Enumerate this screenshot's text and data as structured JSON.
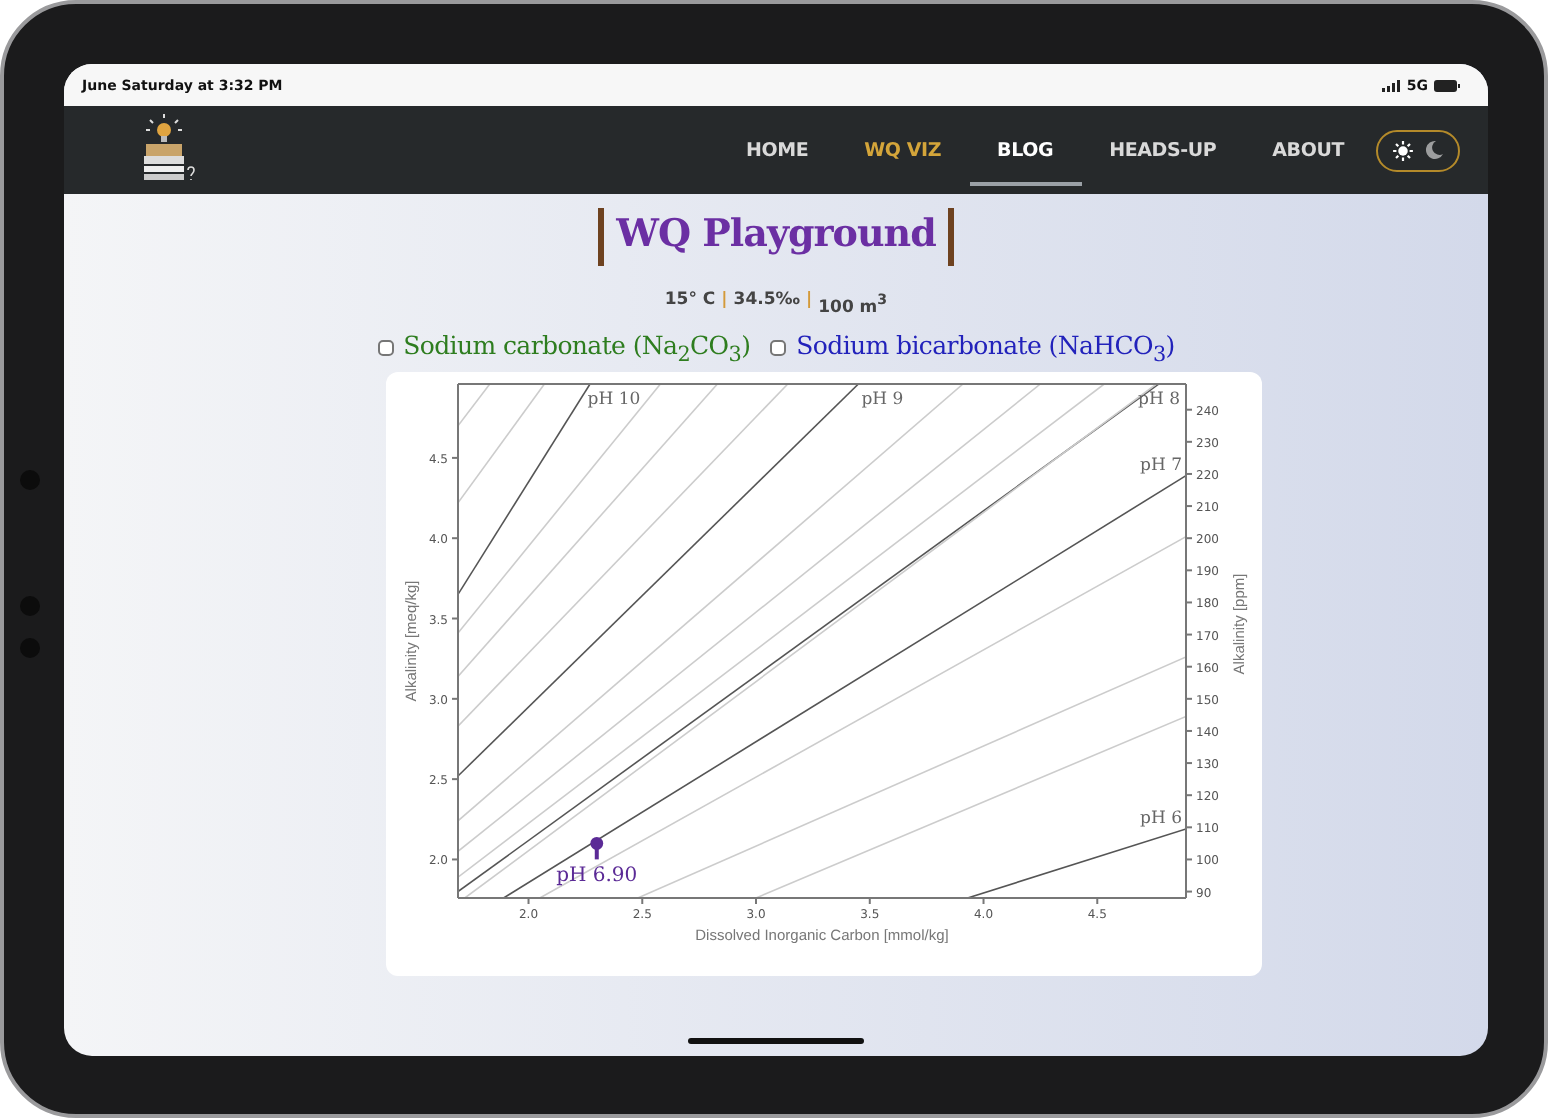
{
  "status_bar": {
    "time": "June Saturday at 3:32 PM",
    "network": "5G"
  },
  "nav": {
    "items": [
      {
        "label": "HOME",
        "selected": false,
        "color": "#d9d9d9"
      },
      {
        "label": "WQ VIZ",
        "selected": false,
        "color": "#d4a53a"
      },
      {
        "label": "BLOG",
        "selected": true,
        "color": "#ffffff"
      },
      {
        "label": "HEADS-UP",
        "selected": false,
        "color": "#d9d9d9"
      },
      {
        "label": "ABOUT",
        "selected": false,
        "color": "#d9d9d9"
      }
    ],
    "theme_toggle": {
      "dark_mode": false
    }
  },
  "title": "WQ Playground",
  "conditions": {
    "items": [
      "15° C",
      "34.5‰",
      "100 m$^{3}$"
    ],
    "separator": "|"
  },
  "options": [
    {
      "label": "Sodium carbonate (Na$_{2}$CO$_{3}$)",
      "checked": false,
      "color": "#2e7d1f"
    },
    {
      "label": "Sodium bicarbonate (NaHCO$_{3}$)",
      "checked": false,
      "color": "#2222bb"
    }
  ],
  "chart_data": {
    "type": "line",
    "xlabel": "Dissolved Inorganic Carbon [mmol/kg]",
    "ylabel": "Alkalinity [meq/kg]",
    "y2label": "Alkalinity [ppm]",
    "xlim": [
      1.69,
      4.89
    ],
    "ylim": [
      1.76,
      4.96
    ],
    "y2lim": [
      88,
      248
    ],
    "xticks": [
      {
        "value": 2.0,
        "label": "2.0"
      },
      {
        "value": 2.5,
        "label": "2.5"
      },
      {
        "value": 3.0,
        "label": "3.0"
      },
      {
        "value": 3.5,
        "label": "3.5"
      },
      {
        "value": 4.0,
        "label": "4.0"
      },
      {
        "value": 4.5,
        "label": "4.5"
      }
    ],
    "yticks": [
      {
        "value": 2.0,
        "label": "2.0"
      },
      {
        "value": 2.5,
        "label": "2.5"
      },
      {
        "value": 3.0,
        "label": "3.0"
      },
      {
        "value": 3.5,
        "label": "3.5"
      },
      {
        "value": 4.0,
        "label": "4.0"
      },
      {
        "value": 4.5,
        "label": "4.5"
      }
    ],
    "y2ticks": [
      90,
      100,
      110,
      120,
      130,
      140,
      150,
      160,
      170,
      180,
      190,
      200,
      210,
      220,
      230,
      240
    ],
    "series": [
      {
        "name": "pH 10",
        "color": "#555555",
        "x": [
          1.69,
          2.27
        ],
        "values": [
          3.65,
          4.96
        ]
      },
      {
        "name": "pH 9",
        "color": "#555555",
        "x": [
          1.69,
          3.45
        ],
        "values": [
          2.52,
          4.96
        ]
      },
      {
        "name": "pH 8",
        "color": "#555555",
        "x": [
          1.69,
          4.77
        ],
        "values": [
          1.8,
          4.96
        ]
      },
      {
        "name": "pH 7",
        "color": "#555555",
        "x": [
          1.89,
          4.89
        ],
        "values": [
          1.76,
          4.39
        ]
      },
      {
        "name": "pH 6",
        "color": "#555555",
        "x": [
          3.93,
          4.89
        ],
        "values": [
          1.76,
          2.19
        ]
      },
      {
        "color": "#cccccc",
        "x": [
          1.69,
          1.83
        ],
        "values": [
          4.7,
          4.96
        ]
      },
      {
        "color": "#cccccc",
        "x": [
          1.69,
          2.07
        ],
        "values": [
          4.22,
          4.96
        ]
      },
      {
        "color": "#cccccc",
        "x": [
          1.69,
          2.58
        ],
        "values": [
          3.41,
          4.96
        ]
      },
      {
        "color": "#cccccc",
        "x": [
          1.69,
          2.83
        ],
        "values": [
          3.14,
          4.96
        ]
      },
      {
        "color": "#cccccc",
        "x": [
          1.69,
          3.14
        ],
        "values": [
          2.83,
          4.96
        ]
      },
      {
        "color": "#cccccc",
        "x": [
          1.69,
          3.91
        ],
        "values": [
          2.24,
          4.96
        ]
      },
      {
        "color": "#cccccc",
        "x": [
          1.69,
          4.25
        ],
        "values": [
          2.05,
          4.96
        ]
      },
      {
        "color": "#cccccc",
        "x": [
          1.69,
          4.53
        ],
        "values": [
          1.89,
          4.96
        ]
      },
      {
        "color": "#cccccc",
        "x": [
          1.72,
          4.76
        ],
        "values": [
          1.76,
          4.96
        ]
      },
      {
        "color": "#cccccc",
        "x": [
          2.05,
          4.89
        ],
        "values": [
          1.76,
          4.01
        ]
      },
      {
        "color": "#cccccc",
        "x": [
          2.48,
          4.89
        ],
        "values": [
          1.76,
          3.26
        ]
      },
      {
        "color": "#cccccc",
        "x": [
          3.0,
          4.89
        ],
        "values": [
          1.76,
          2.89
        ]
      }
    ],
    "annotations": [
      {
        "x": 2.3,
        "y": 2.1,
        "text": "pH 6.90"
      }
    ]
  }
}
